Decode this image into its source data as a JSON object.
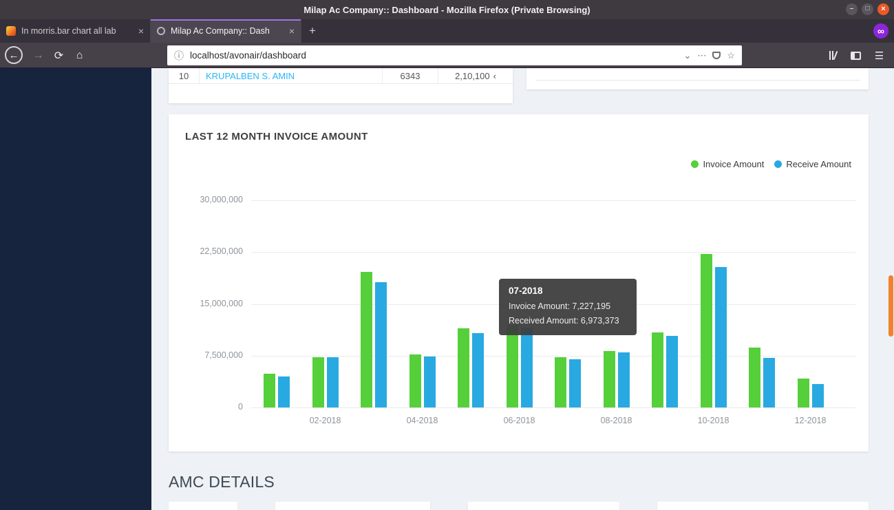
{
  "window": {
    "title": "Milap Ac Company:: Dashboard - Mozilla Firefox (Private Browsing)",
    "controls": {
      "minimize": "–",
      "maximize": "□",
      "close": "×"
    }
  },
  "browser": {
    "tabs": [
      {
        "label": "In morris.bar chart all lab",
        "close": "×"
      },
      {
        "label": "Milap Ac Company:: Dash",
        "close": "×"
      }
    ],
    "new_tab": "+",
    "private_badge": "∞",
    "toolbar": {
      "back": "←",
      "forward": "→",
      "reload": "⟳",
      "home": "⌂",
      "menu": "☰",
      "urlbar": {
        "info": "ⓘ",
        "url": "localhost/avonair/dashboard",
        "chevron": "⌄",
        "page_actions": "⋯",
        "bookmark": "☆"
      }
    }
  },
  "page": {
    "top_table_row": {
      "index": "10",
      "name": "KRUPALBEN S. AMIN",
      "code": "6343",
      "amount": "2,10,100",
      "amount_suffix": "‹"
    },
    "section_heading": "AMC DETAILS"
  },
  "chart_data": {
    "type": "bar",
    "title": "LAST 12 MONTH INVOICE AMOUNT",
    "categories": [
      "01-2018",
      "02-2018",
      "03-2018",
      "04-2018",
      "05-2018",
      "06-2018",
      "07-2018",
      "08-2018",
      "09-2018",
      "10-2018",
      "11-2018",
      "12-2018"
    ],
    "x_tick_labels": [
      "02-2018",
      "04-2018",
      "06-2018",
      "08-2018",
      "10-2018",
      "12-2018"
    ],
    "series": [
      {
        "name": "Invoice Amount",
        "color": "#55cf3a",
        "values": [
          4900000,
          7300000,
          19600000,
          7700000,
          11500000,
          12000000,
          7227195,
          8200000,
          10900000,
          22200000,
          8700000,
          4200000
        ]
      },
      {
        "name": "Receive Amount",
        "color": "#29a9e1",
        "values": [
          4500000,
          7250000,
          18100000,
          7400000,
          10800000,
          11600000,
          6973373,
          8000000,
          10400000,
          20300000,
          7200000,
          3400000
        ]
      }
    ],
    "ylim": [
      0,
      30000000
    ],
    "yticks": [
      "0",
      "7,500,000",
      "15,000,000",
      "22,500,000",
      "30,000,000"
    ],
    "grid": true,
    "legend_position": "top-right",
    "tooltip": {
      "title": "07-2018",
      "lines": [
        "Invoice Amount: 7,227,195",
        "Received Amount: 6,973,373"
      ]
    }
  }
}
